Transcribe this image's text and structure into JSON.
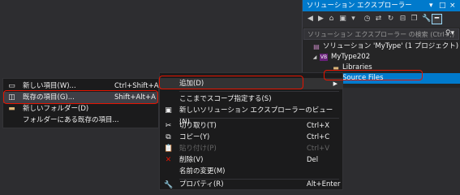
{
  "solution_explorer": {
    "title": "ソリューション エクスプローラー",
    "title_controls": [
      "▾",
      "□",
      "×"
    ],
    "search_placeholder": "ソリューション エクスプローラー の検索 (Ctrl+;)",
    "tree": [
      {
        "label": "ソリューション 'MyType' (1 プロジェクト)",
        "icon": "solution-icon"
      },
      {
        "label": "MyType202",
        "icon": "vb-project-icon"
      },
      {
        "label": "Libraries",
        "icon": "folder-icon"
      },
      {
        "label": "Source Files",
        "icon": "folder-icon",
        "selected": true
      }
    ]
  },
  "context_menu": {
    "items": [
      {
        "label": "追加(D)",
        "shortcut": "",
        "icon": "",
        "submenu": true
      },
      {
        "label": "ここまでスコープ指定する(S)",
        "shortcut": "",
        "icon": ""
      },
      {
        "label": "新しいソリューション エクスプローラーのビュー(N)",
        "shortcut": "",
        "icon": "new-view-icon"
      },
      {
        "label": "切り取り(T)",
        "shortcut": "Ctrl+X",
        "icon": "cut-icon"
      },
      {
        "label": "コピー(Y)",
        "shortcut": "Ctrl+C",
        "icon": "copy-icon"
      },
      {
        "label": "貼り付け(P)",
        "shortcut": "Ctrl+V",
        "icon": "paste-icon",
        "disabled": true
      },
      {
        "label": "削除(V)",
        "shortcut": "Del",
        "icon": "delete-icon"
      },
      {
        "label": "名前の変更(M)",
        "shortcut": "",
        "icon": "rename-icon"
      },
      {
        "label": "プロパティ(R)",
        "shortcut": "Alt+Enter",
        "icon": "properties-icon"
      }
    ]
  },
  "submenu": {
    "items": [
      {
        "label": "新しい項目(W)...",
        "shortcut": "Ctrl+Shift+A",
        "icon": "new-item-icon"
      },
      {
        "label": "既存の項目(G)...",
        "shortcut": "Shift+Alt+A",
        "icon": "existing-item-icon"
      },
      {
        "label": "新しいフォルダー(D)",
        "shortcut": "",
        "icon": "new-folder-icon"
      },
      {
        "label": "フォルダーにある既存の項目...",
        "shortcut": "",
        "icon": ""
      }
    ]
  },
  "colors": {
    "accent": "#007acc",
    "highlight_box": "#e51400",
    "menu_bg": "#1b1b1c",
    "background": "#2d2d30"
  }
}
